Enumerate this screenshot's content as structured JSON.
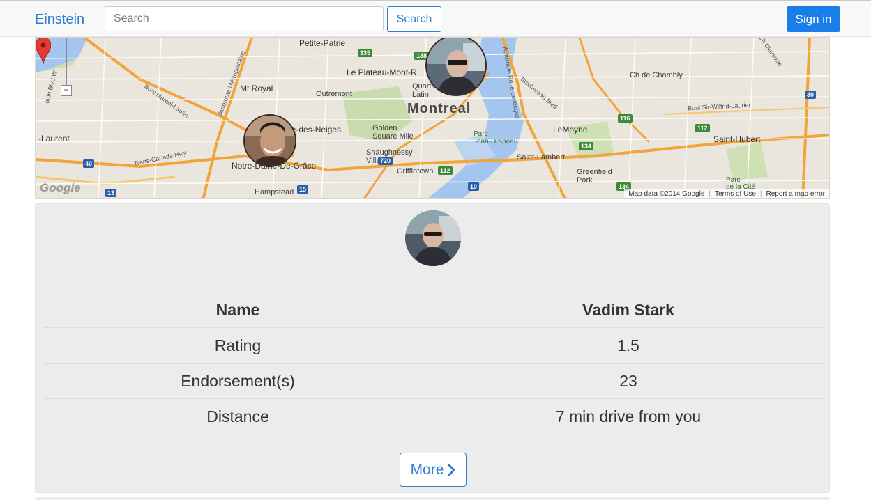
{
  "navbar": {
    "brand": "Einstein",
    "search_placeholder": "Search",
    "search_button": "Search",
    "signin_button": "Sign in"
  },
  "map": {
    "labels": {
      "montreal": "Montreal",
      "petite_patrie": "Petite-Patrie",
      "plateau": "Le Plateau-Mont-R",
      "quartier_latin": "Quartie\nLatin",
      "mt_royal": "Mt Royal",
      "outremont": "Outremont",
      "golden_square_mile": "Golden\nSquare Mile",
      "shaughnessy_village": "Shaughnessy\nVillage",
      "griffintown": "Griffintown",
      "cote_des_neiges": "Côte-des-Neiges",
      "ndg": "Notre-Dame-De-Grâce",
      "hampstead": "Hampstead",
      "st_laurent": "-Laurent",
      "parc_jean_drapeau": "Parc\nJean-Drapeau",
      "lemoyne": "LeMoyne",
      "saint_lambert": "Saint-Lambert",
      "greenfield_park": "Greenfield\nPark",
      "saint_hubert": "Saint-Hubert",
      "chambly": "Ch de Chambly",
      "boul_sir_wilfrid": "Boul Sir-Wilfrid-Laurier",
      "taschereau": "Taschereau Blvd",
      "trans_canada": "Trans-Canada Hwy",
      "autoroute_metro": "Autoroute Métropolitaine",
      "boul_marcel_laurin": "Boul Marcel-Laurin",
      "autoroute_rene": "Autoroute René-Lévesque",
      "parc_de_la_cite": "Parc\nde la Cité",
      "clairevue": "Ch Clairevue",
      "bouin_blvd": "ouin Blvd W"
    },
    "shields": {
      "s335": "335",
      "s138": "138",
      "s116": "116",
      "s112a": "112",
      "s112b": "112",
      "s134a": "134",
      "s134b": "134",
      "s30": "30",
      "s40": "40",
      "s13": "13",
      "s15": "15",
      "s720": "720",
      "s10": "10"
    },
    "google": "Google",
    "footer": {
      "data": "Map data ©2014 Google",
      "terms": "Terms of Use",
      "report": "Report a map error"
    },
    "zoom_out": "−"
  },
  "profile": {
    "rows": [
      {
        "label": "Name",
        "value": "Vadim Stark"
      },
      {
        "label": "Rating",
        "value": "1.5"
      },
      {
        "label": "Endorsement(s)",
        "value": "23"
      },
      {
        "label": "Distance",
        "value": "7 min drive from you"
      }
    ],
    "more_button": "More"
  },
  "colors": {
    "brand": "#2a7fd4",
    "primary_button": "#1a7ee8",
    "card_background": "#ececec"
  }
}
